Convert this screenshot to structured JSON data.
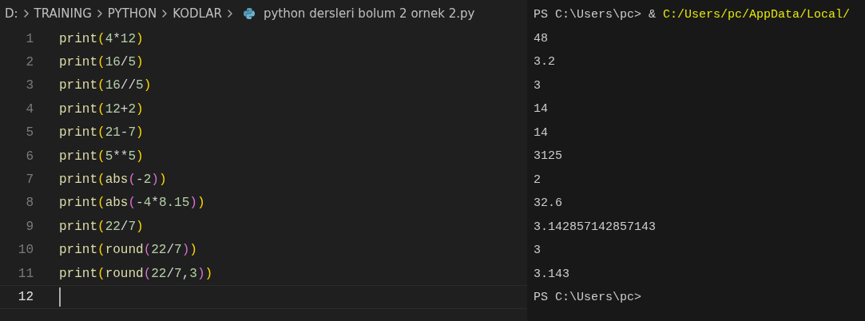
{
  "breadcrumb": {
    "segments": [
      "D:",
      "TRAINING",
      "PYTHON",
      "KODLAR"
    ],
    "file": "python dersleri bolum 2 ornek 2.py"
  },
  "editor": {
    "lines": [
      {
        "number": "1",
        "current": false,
        "tokens": [
          {
            "kind": "function",
            "text": "print"
          },
          {
            "kind": "paren1",
            "text": "("
          },
          {
            "kind": "number",
            "text": "4"
          },
          {
            "kind": "operator",
            "text": "*"
          },
          {
            "kind": "number",
            "text": "12"
          },
          {
            "kind": "paren1",
            "text": ")"
          }
        ]
      },
      {
        "number": "2",
        "current": false,
        "tokens": [
          {
            "kind": "function",
            "text": "print"
          },
          {
            "kind": "paren1",
            "text": "("
          },
          {
            "kind": "number",
            "text": "16"
          },
          {
            "kind": "operator",
            "text": "/"
          },
          {
            "kind": "number",
            "text": "5"
          },
          {
            "kind": "paren1",
            "text": ")"
          }
        ]
      },
      {
        "number": "3",
        "current": false,
        "tokens": [
          {
            "kind": "function",
            "text": "print"
          },
          {
            "kind": "paren1",
            "text": "("
          },
          {
            "kind": "number",
            "text": "16"
          },
          {
            "kind": "operator",
            "text": "//"
          },
          {
            "kind": "number",
            "text": "5"
          },
          {
            "kind": "paren1",
            "text": ")"
          }
        ]
      },
      {
        "number": "4",
        "current": false,
        "tokens": [
          {
            "kind": "function",
            "text": "print"
          },
          {
            "kind": "paren1",
            "text": "("
          },
          {
            "kind": "number",
            "text": "12"
          },
          {
            "kind": "operator",
            "text": "+"
          },
          {
            "kind": "number",
            "text": "2"
          },
          {
            "kind": "paren1",
            "text": ")"
          }
        ]
      },
      {
        "number": "5",
        "current": false,
        "tokens": [
          {
            "kind": "function",
            "text": "print"
          },
          {
            "kind": "paren1",
            "text": "("
          },
          {
            "kind": "number",
            "text": "21"
          },
          {
            "kind": "operator",
            "text": "-"
          },
          {
            "kind": "number",
            "text": "7"
          },
          {
            "kind": "paren1",
            "text": ")"
          }
        ]
      },
      {
        "number": "6",
        "current": false,
        "tokens": [
          {
            "kind": "function",
            "text": "print"
          },
          {
            "kind": "paren1",
            "text": "("
          },
          {
            "kind": "number",
            "text": "5"
          },
          {
            "kind": "operator",
            "text": "**"
          },
          {
            "kind": "number",
            "text": "5"
          },
          {
            "kind": "paren1",
            "text": ")"
          }
        ]
      },
      {
        "number": "7",
        "current": false,
        "tokens": [
          {
            "kind": "function",
            "text": "print"
          },
          {
            "kind": "paren1",
            "text": "("
          },
          {
            "kind": "function",
            "text": "abs"
          },
          {
            "kind": "paren2",
            "text": "("
          },
          {
            "kind": "operator",
            "text": "-"
          },
          {
            "kind": "number",
            "text": "2"
          },
          {
            "kind": "paren2",
            "text": ")"
          },
          {
            "kind": "paren1",
            "text": ")"
          }
        ]
      },
      {
        "number": "8",
        "current": false,
        "tokens": [
          {
            "kind": "function",
            "text": "print"
          },
          {
            "kind": "paren1",
            "text": "("
          },
          {
            "kind": "function",
            "text": "abs"
          },
          {
            "kind": "paren2",
            "text": "("
          },
          {
            "kind": "operator",
            "text": "-"
          },
          {
            "kind": "number",
            "text": "4"
          },
          {
            "kind": "operator",
            "text": "*"
          },
          {
            "kind": "number",
            "text": "8.15"
          },
          {
            "kind": "paren2",
            "text": ")"
          },
          {
            "kind": "paren1",
            "text": ")"
          }
        ]
      },
      {
        "number": "9",
        "current": false,
        "tokens": [
          {
            "kind": "function",
            "text": "print"
          },
          {
            "kind": "paren1",
            "text": "("
          },
          {
            "kind": "number",
            "text": "22"
          },
          {
            "kind": "operator",
            "text": "/"
          },
          {
            "kind": "number",
            "text": "7"
          },
          {
            "kind": "paren1",
            "text": ")"
          }
        ]
      },
      {
        "number": "10",
        "current": false,
        "tokens": [
          {
            "kind": "function",
            "text": "print"
          },
          {
            "kind": "paren1",
            "text": "("
          },
          {
            "kind": "function",
            "text": "round"
          },
          {
            "kind": "paren2",
            "text": "("
          },
          {
            "kind": "number",
            "text": "22"
          },
          {
            "kind": "operator",
            "text": "/"
          },
          {
            "kind": "number",
            "text": "7"
          },
          {
            "kind": "paren2",
            "text": ")"
          },
          {
            "kind": "paren1",
            "text": ")"
          }
        ]
      },
      {
        "number": "11",
        "current": false,
        "tokens": [
          {
            "kind": "function",
            "text": "print"
          },
          {
            "kind": "paren1",
            "text": "("
          },
          {
            "kind": "function",
            "text": "round"
          },
          {
            "kind": "paren2",
            "text": "("
          },
          {
            "kind": "number",
            "text": "22"
          },
          {
            "kind": "operator",
            "text": "/"
          },
          {
            "kind": "number",
            "text": "7"
          },
          {
            "kind": "operator",
            "text": ","
          },
          {
            "kind": "number",
            "text": "3"
          },
          {
            "kind": "paren2",
            "text": ")"
          },
          {
            "kind": "paren1",
            "text": ")"
          }
        ]
      },
      {
        "number": "12",
        "current": true
      }
    ]
  },
  "terminal": {
    "lines": [
      {
        "tokens": [
          {
            "kind": "plain",
            "text": "PS C:\\Users\\pc> & "
          },
          {
            "kind": "path",
            "text": "C:/Users/pc/AppData/Local/"
          }
        ]
      },
      {
        "tokens": [
          {
            "kind": "plain",
            "text": "48"
          }
        ]
      },
      {
        "tokens": [
          {
            "kind": "plain",
            "text": "3.2"
          }
        ]
      },
      {
        "tokens": [
          {
            "kind": "plain",
            "text": "3"
          }
        ]
      },
      {
        "tokens": [
          {
            "kind": "plain",
            "text": "14"
          }
        ]
      },
      {
        "tokens": [
          {
            "kind": "plain",
            "text": "14"
          }
        ]
      },
      {
        "tokens": [
          {
            "kind": "plain",
            "text": "3125"
          }
        ]
      },
      {
        "tokens": [
          {
            "kind": "plain",
            "text": "2"
          }
        ]
      },
      {
        "tokens": [
          {
            "kind": "plain",
            "text": "32.6"
          }
        ]
      },
      {
        "tokens": [
          {
            "kind": "plain",
            "text": "3.142857142857143"
          }
        ]
      },
      {
        "tokens": [
          {
            "kind": "plain",
            "text": "3"
          }
        ]
      },
      {
        "tokens": [
          {
            "kind": "plain",
            "text": "3.143"
          }
        ]
      },
      {
        "tokens": [
          {
            "kind": "plain",
            "text": "PS C:\\Users\\pc>"
          }
        ]
      }
    ]
  }
}
